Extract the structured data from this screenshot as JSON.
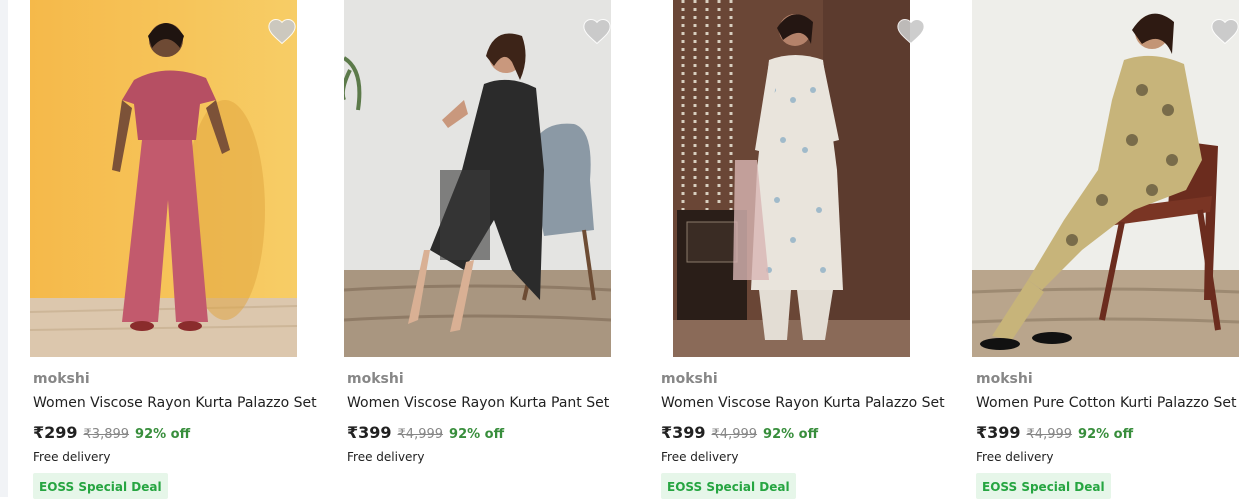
{
  "colors": {
    "price_discount": "#388e3c",
    "deal_badge_bg": "#e6f6e9",
    "deal_badge_text": "#26a541",
    "brand_text": "#878787",
    "heart_icon": "#c8c8c8"
  },
  "products": [
    {
      "brand": "mokshi",
      "title": "Women Viscose Rayon Kurta Palazzo Set",
      "price": "₹299",
      "mrp": "₹3,899",
      "discount": "92% off",
      "delivery": "Free delivery",
      "deal": "EOSS Special Deal",
      "wishlist_icon": "heart-icon"
    },
    {
      "brand": "mokshi",
      "title": "Women Viscose Rayon Kurta Pant Set",
      "price": "₹399",
      "mrp": "₹4,999",
      "discount": "92% off",
      "delivery": "Free delivery",
      "wishlist_icon": "heart-icon"
    },
    {
      "brand": "mokshi",
      "title": "Women Viscose Rayon Kurta Palazzo Set",
      "price": "₹399",
      "mrp": "₹4,999",
      "discount": "92% off",
      "delivery": "Free delivery",
      "deal": "EOSS Special Deal",
      "wishlist_icon": "heart-icon"
    },
    {
      "brand": "mokshi",
      "title": "Women Pure Cotton Kurti Palazzo Set",
      "price": "₹399",
      "mrp": "₹4,999",
      "discount": "92% off",
      "delivery": "Free delivery",
      "deal": "EOSS Special Deal",
      "wishlist_icon": "heart-icon"
    }
  ]
}
